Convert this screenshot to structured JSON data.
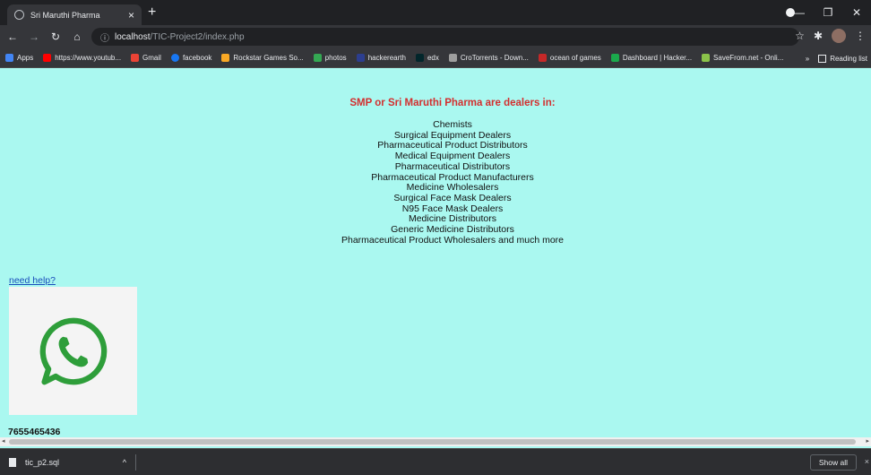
{
  "browser": {
    "tab_title": "Sri Maruthi Pharma",
    "tab_close": "×",
    "new_tab": "+",
    "url_host": "localhost",
    "url_path": "/TIC-Project2/index.php",
    "bookmarks": [
      {
        "label": "Apps",
        "color": "#4285f4"
      },
      {
        "label": "https://www.youtub...",
        "color": "#ff0000"
      },
      {
        "label": "Gmail",
        "color": "#ea4335"
      },
      {
        "label": "facebook",
        "color": "#1877f2"
      },
      {
        "label": "Rockstar Games So...",
        "color": "#f9a825"
      },
      {
        "label": "photos",
        "color": "#34a853"
      },
      {
        "label": "hackerearth",
        "color": "#2c3e8f"
      },
      {
        "label": "edx",
        "color": "#02262b"
      },
      {
        "label": "CroTorrents - Down...",
        "color": "#9e9e9e"
      },
      {
        "label": "ocean of games",
        "color": "#c62828"
      },
      {
        "label": "Dashboard | Hacker...",
        "color": "#1ba94c"
      },
      {
        "label": "SaveFrom.net - Onli...",
        "color": "#8bc34a"
      }
    ],
    "bookmarks_more": "»",
    "reading_list": "Reading list"
  },
  "page": {
    "heading": "SMP or Sri Maruthi Pharma are dealers in:",
    "dealers": [
      "Chemists",
      "Surgical Equipment Dealers",
      "Pharmaceutical Product Distributors",
      "Medical Equipment Dealers",
      "Pharmaceutical Distributors",
      "Pharmaceutical Product Manufacturers",
      "Medicine Wholesalers",
      "Surgical Face Mask Dealers",
      "N95 Face Mask Dealers",
      "Medicine Distributors",
      "Generic Medicine Distributors",
      "Pharmaceutical Product Wholesalers and much more"
    ],
    "help_link": "need help?",
    "phone": "7655465436",
    "whatsapp_icon": "whatsapp-icon",
    "whatsapp_color": "#2e9e3a",
    "background": "#aaf8f0",
    "heading_color": "#d32f2f"
  },
  "downloads": {
    "file": "tic_p2.sql",
    "chevron": "^",
    "show_all": "Show all",
    "close": "×"
  }
}
